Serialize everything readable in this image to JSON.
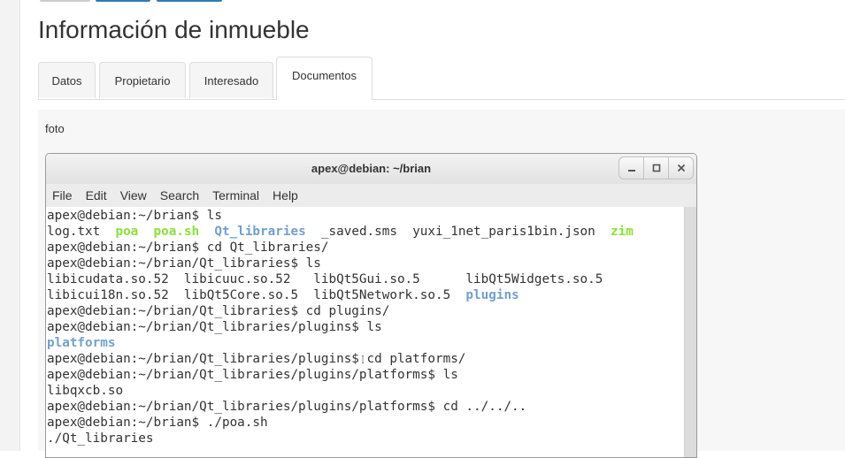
{
  "page": {
    "title": "Información de inmueble",
    "tabs": [
      {
        "label": "Datos",
        "active": false
      },
      {
        "label": "Propietario",
        "active": false
      },
      {
        "label": "Interesado",
        "active": false
      },
      {
        "label": "Documentos",
        "active": true
      }
    ],
    "field_label": "foto"
  },
  "terminal": {
    "title": "apex@debian: ~/brian",
    "window_buttons": [
      "minimize-icon",
      "maximize-icon",
      "close-icon"
    ],
    "menu": [
      "File",
      "Edit",
      "View",
      "Search",
      "Terminal",
      "Help"
    ],
    "lines": [
      [
        {
          "t": "apex@debian:~/brian$ ls",
          "c": ""
        }
      ],
      [
        {
          "t": "log.txt  ",
          "c": ""
        },
        {
          "t": "poa",
          "c": "exec"
        },
        {
          "t": "  ",
          "c": ""
        },
        {
          "t": "poa.sh",
          "c": "exec"
        },
        {
          "t": "  ",
          "c": ""
        },
        {
          "t": "Qt_libraries",
          "c": "dir"
        },
        {
          "t": "  _saved.sms  yuxi_1net_paris1bin.json  ",
          "c": ""
        },
        {
          "t": "zim",
          "c": "exec"
        }
      ],
      [
        {
          "t": "apex@debian:~/brian$ cd Qt_libraries/",
          "c": ""
        }
      ],
      [
        {
          "t": "apex@debian:~/brian/Qt_libraries$ ls",
          "c": ""
        }
      ],
      [
        {
          "t": "libicudata.so.52  libicuuc.so.52   libQt5Gui.so.5      libQt5Widgets.so.5",
          "c": ""
        }
      ],
      [
        {
          "t": "libicui18n.so.52  libQt5Core.so.5  libQt5Network.so.5  ",
          "c": ""
        },
        {
          "t": "plugins",
          "c": "dir"
        }
      ],
      [
        {
          "t": "apex@debian:~/brian/Qt_libraries$ cd plugins/",
          "c": ""
        }
      ],
      [
        {
          "t": "apex@debian:~/brian/Qt_libraries/plugins$ ls",
          "c": ""
        }
      ],
      [
        {
          "t": "platforms",
          "c": "dir"
        }
      ],
      [
        {
          "t": "apex@debian:~/brian/Qt_libraries/plugins$ cd platforms/",
          "c": ""
        }
      ],
      [
        {
          "t": "apex@debian:~/brian/Qt_libraries/plugins/platforms$ ls",
          "c": ""
        }
      ],
      [
        {
          "t": "libqxcb.so",
          "c": ""
        }
      ],
      [
        {
          "t": "apex@debian:~/brian/Qt_libraries/plugins/platforms$ cd ../../..",
          "c": ""
        }
      ],
      [
        {
          "t": "apex@debian:~/brian$ ./poa.sh",
          "c": ""
        }
      ],
      [
        {
          "t": "./Qt_libraries",
          "c": ""
        }
      ]
    ]
  },
  "colors": {
    "exec": "#8ae234",
    "dir": "#729fcf",
    "top_button": "#337ab7"
  }
}
